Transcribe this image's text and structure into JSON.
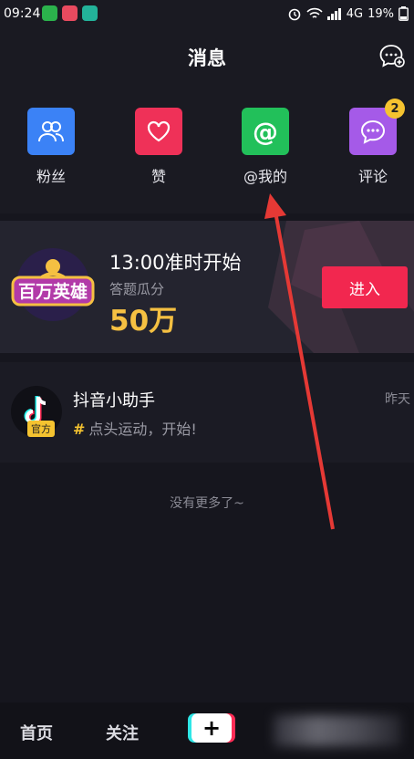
{
  "status_bar": {
    "time": "09:24",
    "network": "4G",
    "battery": "19%"
  },
  "header": {
    "title": "消息"
  },
  "categories": [
    {
      "label": "粉丝",
      "icon": "fans-icon",
      "color": "#3b82f6"
    },
    {
      "label": "赞",
      "icon": "heart-icon",
      "color": "#ef3158"
    },
    {
      "label": "@我的",
      "icon": "at-icon",
      "color": "#22c05a"
    },
    {
      "label": "评论",
      "icon": "comment-icon",
      "color": "#a55ae8",
      "badge": "2"
    }
  ],
  "banner": {
    "logo_text": "百万英雄",
    "title": "13:00准时开始",
    "subtitle": "答题瓜分",
    "amount": "50万",
    "button": "进入"
  },
  "messages": [
    {
      "name": "抖音小助手",
      "preview": "点头运动，开始!",
      "time": "昨天",
      "badge": "官方"
    }
  ],
  "footer_text": "没有更多了~",
  "bottom_nav": {
    "home": "首页",
    "follow": "关注",
    "add": "+"
  }
}
